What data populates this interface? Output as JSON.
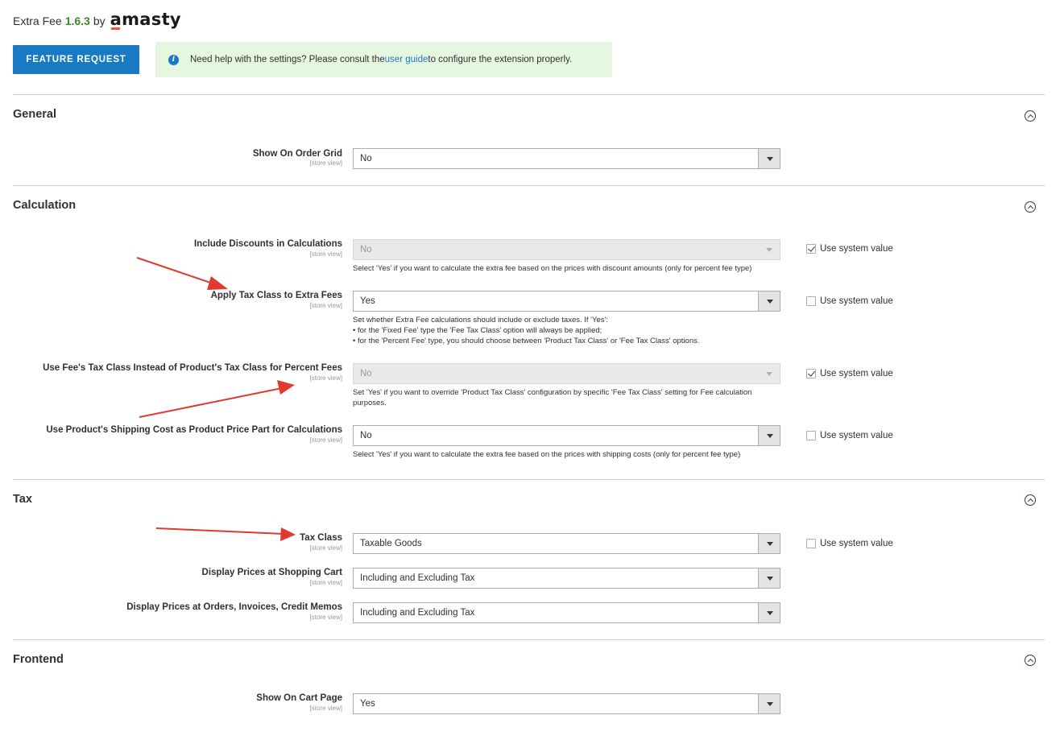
{
  "header": {
    "title": "Extra Fee",
    "version": "1.6.3",
    "by": "by",
    "logo": "amasty"
  },
  "feature_button": "FEATURE REQUEST",
  "notice": {
    "before": "Need help with the settings? Please consult the ",
    "link": "user guide",
    "after": " to configure the extension properly."
  },
  "scope_label": "[store view]",
  "use_system_value": "Use system value",
  "sections": {
    "general": {
      "title": "General",
      "show_on_order_grid": {
        "label": "Show On Order Grid",
        "value": "No"
      }
    },
    "calculation": {
      "title": "Calculation",
      "include_discounts": {
        "label": "Include Discounts in Calculations",
        "value": "No",
        "use_system": true,
        "note": "Select 'Yes' if you want to calculate the extra fee based on the prices with discount amounts (only for percent fee type)"
      },
      "apply_tax_class": {
        "label": "Apply Tax Class to Extra Fees",
        "value": "Yes",
        "use_system": false,
        "note1": "Set whether Extra Fee calculations should include or exclude taxes. If 'Yes':",
        "note2": "• for the 'Fixed Fee' type the 'Fee Tax Class' option will always be applied;",
        "note3": "• for the 'Percent Fee' type, you should choose between 'Product Tax Class' or 'Fee Tax Class' options."
      },
      "use_fee_tax_class": {
        "label": "Use Fee's Tax Class Instead of Product's Tax Class for Percent Fees",
        "value": "No",
        "use_system": true,
        "note": "Set 'Yes' if you want to override 'Product Tax Class' configuration by specific 'Fee Tax Class' setting for Fee calculation purposes."
      },
      "shipping_cost": {
        "label": "Use Product's Shipping Cost as Product Price Part for Calculations",
        "value": "No",
        "use_system": false,
        "note": "Select 'Yes' if you want to calculate the extra fee based on the prices with shipping costs (only for percent fee type)"
      }
    },
    "tax": {
      "title": "Tax",
      "tax_class": {
        "label": "Tax Class",
        "value": "Taxable Goods",
        "use_system": false
      },
      "display_cart": {
        "label": "Display Prices at Shopping Cart",
        "value": "Including and Excluding Tax"
      },
      "display_orders": {
        "label": "Display Prices at Orders, Invoices, Credit Memos",
        "value": "Including and Excluding Tax"
      }
    },
    "frontend": {
      "title": "Frontend",
      "show_on_cart": {
        "label": "Show On Cart Page",
        "value": "Yes"
      }
    }
  },
  "colors": {
    "accent": "#1979c3",
    "notice_bg": "#e5f7e1",
    "version": "#3c8b1f",
    "annotation_arrow": "#e03a2f"
  }
}
